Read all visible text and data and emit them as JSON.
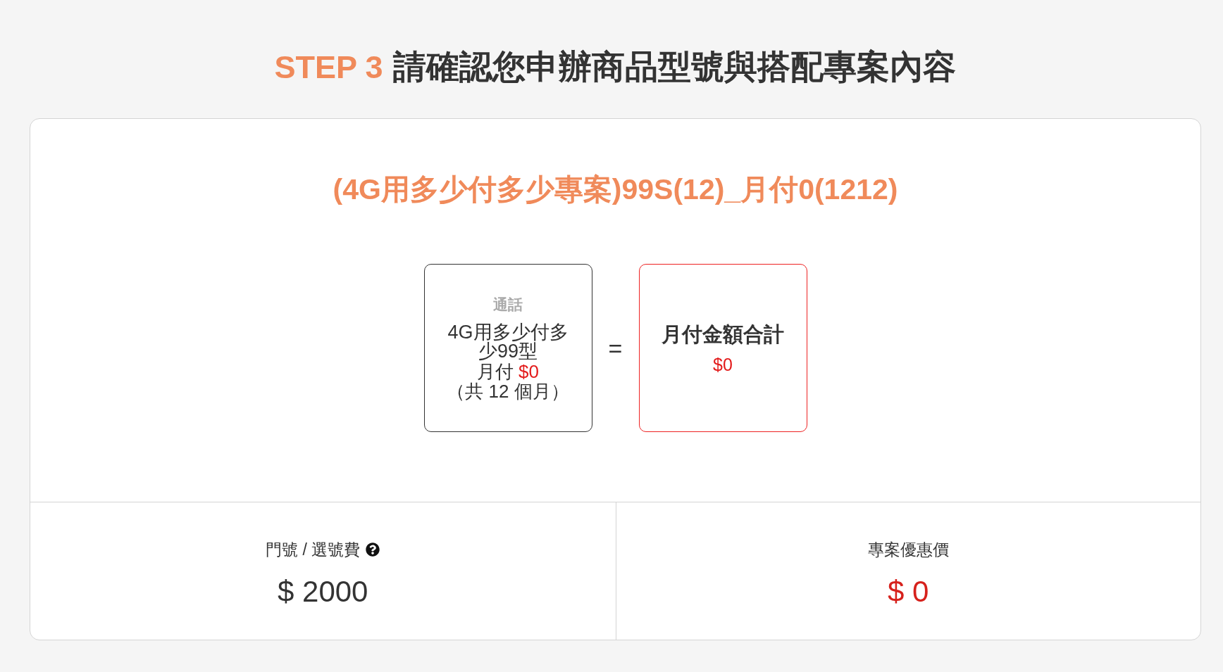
{
  "heading": {
    "step": "STEP 3",
    "title": "請確認您申辦商品型號與搭配專案內容"
  },
  "plan": {
    "name": "(4G用多少付多少專案)99S(12)_月付0(1212)"
  },
  "formula": {
    "items": [
      {
        "kind": "plan",
        "category": "通話",
        "name": "4G用多少付多少99型",
        "price_label": "月付",
        "price": "$0",
        "term": "（共 12 個月）"
      }
    ],
    "operator": "=",
    "total": {
      "label": "月付金額合計",
      "price": "$0"
    }
  },
  "fees": [
    {
      "label": "門號 / 選號費",
      "help": true,
      "value": "$ 2000",
      "highlighted": false
    },
    {
      "label": "專案優惠價",
      "help": false,
      "value": "$ 0",
      "highlighted": true
    }
  ]
}
